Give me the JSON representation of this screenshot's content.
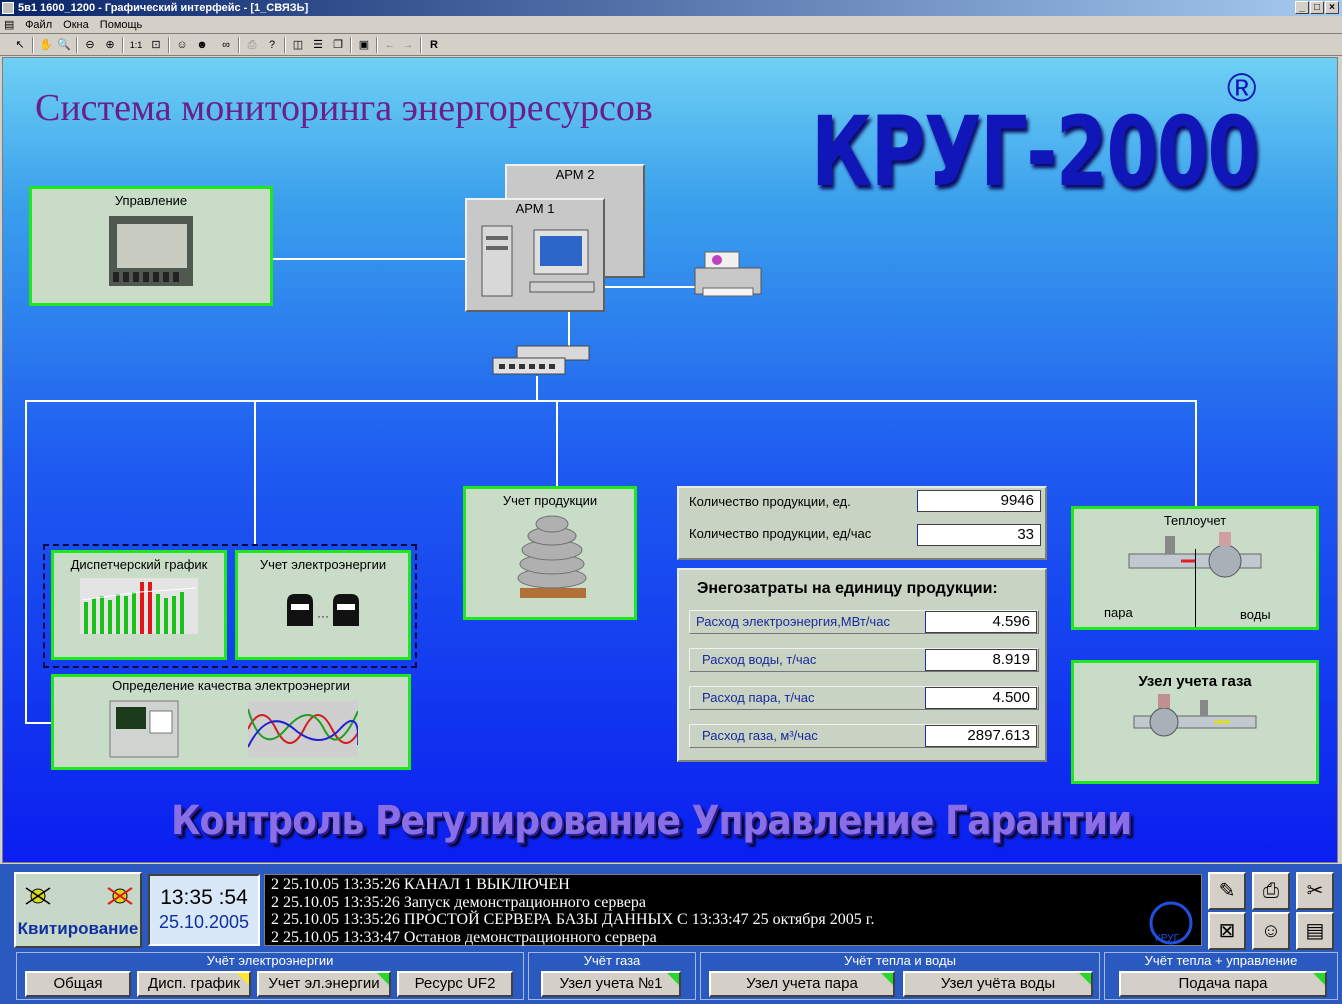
{
  "window": {
    "title": "5в1 1600_1200 - Графический интерфейс - [1_СВЯЗЬ]"
  },
  "menu": [
    "Файл",
    "Окна",
    "Помощь"
  ],
  "header": {
    "heading": "Система мониторинга энергоресурсов",
    "logo": "КРУГ-2000",
    "registered": "®",
    "slogan": "Контроль Регулирование Управление Гарантии"
  },
  "nodes": {
    "arm2": "АРМ 2",
    "arm1": "АРМ 1",
    "control": "Управление",
    "product": "Учет продукции",
    "dispatch": "Диспетчерский график",
    "electric": "Учет электроэнергии",
    "quality": "Определение качества электроэнергии",
    "heat": "Теплоучет",
    "heat_left": "пара",
    "heat_right": "воды",
    "gas": "Узел учета газа"
  },
  "production": {
    "rows": [
      {
        "label": "Количество продукции, ед.",
        "value": "9946"
      },
      {
        "label": "Количество продукции, ед/час",
        "value": "33"
      }
    ]
  },
  "energy": {
    "title": "Энегозатраты на единицу продукции:",
    "rows": [
      {
        "label": "Расход электроэнергия,МВт/час",
        "value": "4.596"
      },
      {
        "label": "Расход воды, т/час",
        "value": "8.919"
      },
      {
        "label": "Расход пара, т/час",
        "value": "4.500"
      },
      {
        "label": "Расход газа, м³/час",
        "value": "2897.613"
      }
    ]
  },
  "status": {
    "ack": "Квитирование",
    "time": "13:35 :54",
    "date": "25.10.2005",
    "messages": [
      "2  25.10.05 13:35:26 КАНАЛ 1 ВЫКЛЮЧЕН",
      "2  25.10.05 13:35:26 Запуск демонстрационного сервера",
      "2  25.10.05 13:35:26 ПРОСТОЙ СЕРВЕРА БАЗЫ ДАННЫХ С 13:33:47  25 октября 2005 г.",
      "2  25.10.05 13:33:47 Останов демонстрационного сервера"
    ],
    "krug": "КРУГ"
  },
  "groups": {
    "electric": "Учёт электроэнергии",
    "gas": "Учёт газа",
    "heat": "Учёт тепла и воды",
    "heatctl": "Учёт тепла + управление"
  },
  "buttons": {
    "common": "Общая",
    "disp": "Дисп. график",
    "eluch": "Учет эл.энергии",
    "uf2": "Ресурс UF2",
    "gas1": "Узел учета №1",
    "steam": "Узел учета пара",
    "water": "Узел учёта воды",
    "feed": "Подача пара"
  },
  "colors": {
    "ok": "#1ce81c",
    "heading": "#6a1f8a",
    "logo": "#1016b8"
  }
}
